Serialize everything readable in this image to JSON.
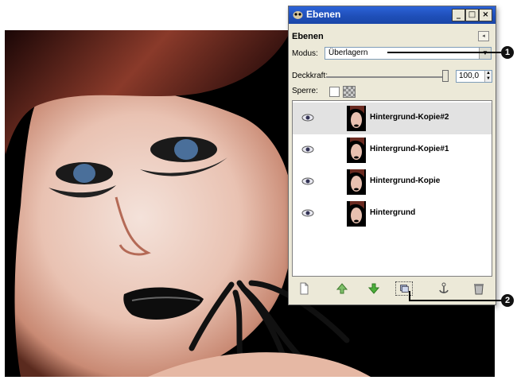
{
  "window": {
    "title": "Ebenen",
    "minimize_glyph": "_",
    "maximize_glyph": "□",
    "close_glyph": "×"
  },
  "dock": {
    "title": "Ebenen"
  },
  "mode": {
    "label": "Modus:",
    "value": "Überlagern"
  },
  "opacity": {
    "label": "Deckkraft:",
    "value": "100,0",
    "level_percent": 100
  },
  "lock": {
    "label": "Sperre:"
  },
  "layers": [
    {
      "name": "Hintergrund-Kopie#2",
      "active": true
    },
    {
      "name": "Hintergrund-Kopie#1",
      "active": false
    },
    {
      "name": "Hintergrund-Kopie",
      "active": false
    },
    {
      "name": "Hintergrund",
      "active": false
    }
  ],
  "toolbar_icons": [
    "new-layer-icon",
    "raise-layer-icon",
    "lower-layer-icon",
    "duplicate-layer-icon",
    "anchor-layer-icon",
    "delete-layer-icon"
  ],
  "callouts": [
    "1",
    "2"
  ],
  "colors": {
    "titlebar": "#1f4fb9",
    "dialog_bg": "#ece9d8",
    "arrow_green": "#4caf3a"
  }
}
